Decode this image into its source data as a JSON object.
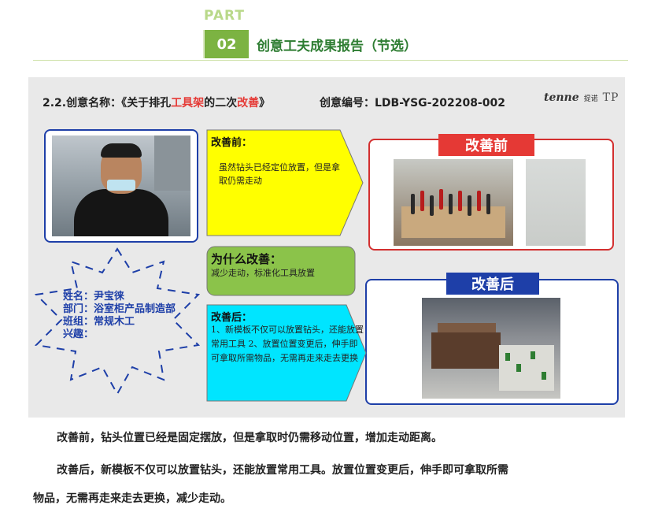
{
  "header": {
    "part_label": "PART",
    "section_number": "02",
    "section_title": "创意工夫成果报告（节选）"
  },
  "slide": {
    "title_prefix": "2.2.创意名称：《关于排孔",
    "title_red1": "工具架",
    "title_mid": "的二次",
    "title_red2": "改善",
    "title_suffix": "》",
    "code_label": "创意编号：LDB-YSG-202208-002",
    "logo": {
      "brand": "tenne",
      "brand_cn": "提诺",
      "mark": "TP"
    },
    "before_badge": "改善前",
    "after_badge": "改善后",
    "callouts": {
      "before": {
        "title": "改善前：",
        "body": "虽然钻头已经定位放置，但是拿取仍需走动"
      },
      "why": {
        "title": "为什么改善：",
        "body": "减少走动，标准化工具放置"
      },
      "after": {
        "title": "改善后：",
        "body": "1、新模板不仅可以放置钻头，还能放置常用工具 2、放置位置变更后，伸手即可拿取所需物品，无需再走来走去更换"
      }
    },
    "person": {
      "name": "姓名：尹宝徕",
      "dept": "部门：浴室柜产品制造部",
      "team": "班组：常规木工",
      "hobby": "兴趣："
    },
    "colors": {
      "red": "#e53935",
      "blue": "#1e3fa8",
      "yellow": "#ffff00",
      "green": "#8bc34a",
      "cyan": "#00e5ff"
    }
  },
  "paragraphs": {
    "p1": "改善前，钻头位置已经是固定摆放，但是拿取时仍需移动位置，增加走动距离。",
    "p2": "改善后，新模板不仅可以放置钻头，还能放置常用工具。放置位置变更后，伸手即可拿取所需",
    "p3": "物品，无需再走来走去更换，减少走动。"
  }
}
